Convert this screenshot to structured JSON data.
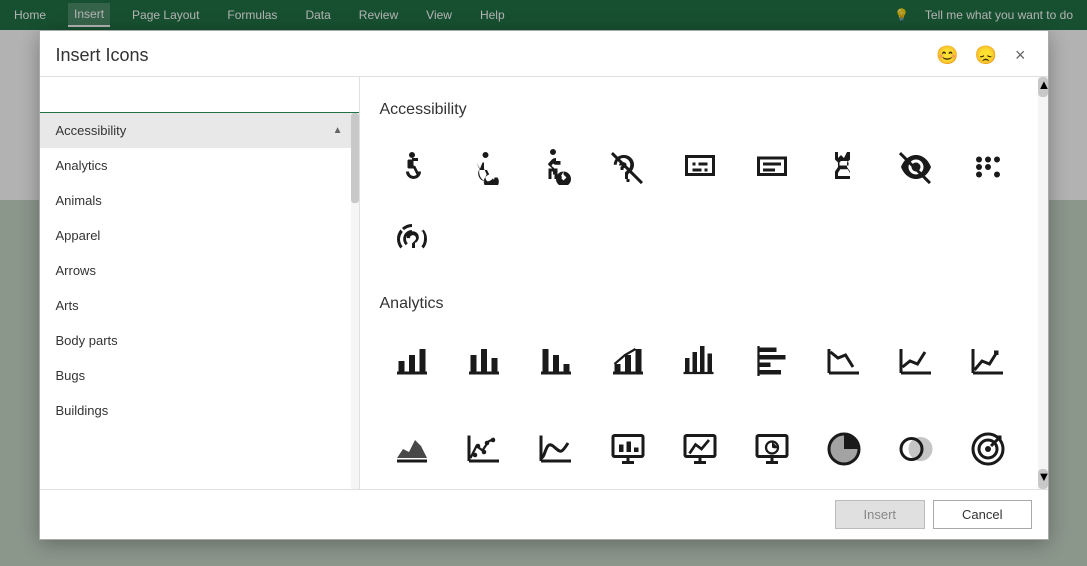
{
  "ribbon": {
    "tabs": [
      "Home",
      "Insert",
      "Page Layout",
      "Formulas",
      "Data",
      "Review",
      "View",
      "Help"
    ],
    "active_tab": "Insert",
    "tell_me_placeholder": "Tell me what you want to do",
    "tell_me_icon": "💡"
  },
  "dialog": {
    "title": "Insert Icons",
    "close_label": "×",
    "happy_icon": "😊",
    "sad_icon": "😞",
    "search_placeholder": "",
    "categories": [
      {
        "label": "Accessibility",
        "active": true
      },
      {
        "label": "Analytics",
        "active": false
      },
      {
        "label": "Animals",
        "active": false
      },
      {
        "label": "Apparel",
        "active": false
      },
      {
        "label": "Arrows",
        "active": false
      },
      {
        "label": "Arts",
        "active": false
      },
      {
        "label": "Body parts",
        "active": false
      },
      {
        "label": "Bugs",
        "active": false
      },
      {
        "label": "Buildings",
        "active": false
      }
    ],
    "sections": [
      {
        "title": "Accessibility",
        "icons": [
          "wheelchair",
          "wheelchair-active",
          "accessible-forward",
          "hearing-impaired",
          "caption",
          "caption-alt",
          "sign-language",
          "low-vision",
          "braille",
          "hearing-aid"
        ]
      },
      {
        "title": "Analytics",
        "icons": [
          "bar-chart",
          "bar-chart-2",
          "bar-chart-down",
          "bar-chart-up",
          "bar-chart-detail",
          "bar-chart-side",
          "line-chart-down",
          "line-chart-up",
          "line-chart-trend",
          "area-chart-down",
          "scatter-chart",
          "curve-chart",
          "presentation-chart",
          "presentation-chart-2",
          "presentation-chart-3",
          "pie-chart",
          "venn-diagram",
          "target"
        ]
      }
    ],
    "footer": {
      "insert_label": "Insert",
      "cancel_label": "Cancel"
    }
  }
}
